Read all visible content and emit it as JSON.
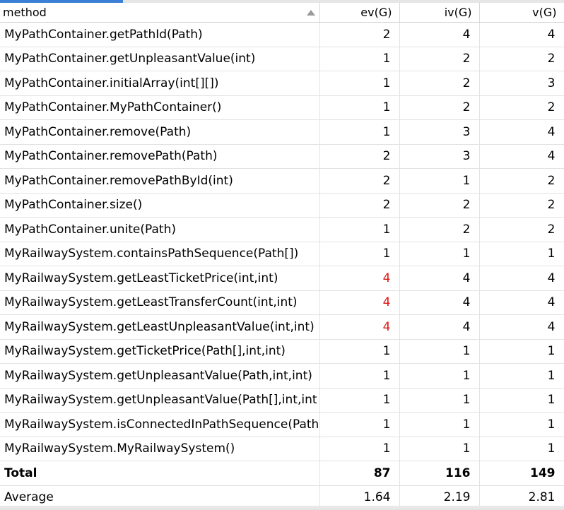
{
  "columns": {
    "method": "method",
    "ev": "ev(G)",
    "iv": "iv(G)",
    "v": "v(G)"
  },
  "colors": {
    "warning": "#e01515",
    "accent": "#3c7fd6"
  },
  "sort_icon": "sort-ascending-icon",
  "rows": [
    {
      "method": "MyPathContainer.getPathId(Path)",
      "ev": "2",
      "iv": "4",
      "v": "4",
      "ev_warn": false
    },
    {
      "method": "MyPathContainer.getUnpleasantValue(int)",
      "ev": "1",
      "iv": "2",
      "v": "2",
      "ev_warn": false
    },
    {
      "method": "MyPathContainer.initialArray(int[][])",
      "ev": "1",
      "iv": "2",
      "v": "3",
      "ev_warn": false
    },
    {
      "method": "MyPathContainer.MyPathContainer()",
      "ev": "1",
      "iv": "2",
      "v": "2",
      "ev_warn": false
    },
    {
      "method": "MyPathContainer.remove(Path)",
      "ev": "1",
      "iv": "3",
      "v": "4",
      "ev_warn": false
    },
    {
      "method": "MyPathContainer.removePath(Path)",
      "ev": "2",
      "iv": "3",
      "v": "4",
      "ev_warn": false
    },
    {
      "method": "MyPathContainer.removePathById(int)",
      "ev": "2",
      "iv": "1",
      "v": "2",
      "ev_warn": false
    },
    {
      "method": "MyPathContainer.size()",
      "ev": "2",
      "iv": "2",
      "v": "2",
      "ev_warn": false
    },
    {
      "method": "MyPathContainer.unite(Path)",
      "ev": "1",
      "iv": "2",
      "v": "2",
      "ev_warn": false
    },
    {
      "method": "MyRailwaySystem.containsPathSequence(Path[])",
      "ev": "1",
      "iv": "1",
      "v": "1",
      "ev_warn": false
    },
    {
      "method": "MyRailwaySystem.getLeastTicketPrice(int,int)",
      "ev": "4",
      "iv": "4",
      "v": "4",
      "ev_warn": true
    },
    {
      "method": "MyRailwaySystem.getLeastTransferCount(int,int)",
      "ev": "4",
      "iv": "4",
      "v": "4",
      "ev_warn": true
    },
    {
      "method": "MyRailwaySystem.getLeastUnpleasantValue(int,int)",
      "ev": "4",
      "iv": "4",
      "v": "4",
      "ev_warn": true
    },
    {
      "method": "MyRailwaySystem.getTicketPrice(Path[],int,int)",
      "ev": "1",
      "iv": "1",
      "v": "1",
      "ev_warn": false
    },
    {
      "method": "MyRailwaySystem.getUnpleasantValue(Path,int,int)",
      "ev": "1",
      "iv": "1",
      "v": "1",
      "ev_warn": false
    },
    {
      "method": "MyRailwaySystem.getUnpleasantValue(Path[],int,int",
      "ev": "1",
      "iv": "1",
      "v": "1",
      "ev_warn": false
    },
    {
      "method": "MyRailwaySystem.isConnectedInPathSequence(Path",
      "ev": "1",
      "iv": "1",
      "v": "1",
      "ev_warn": false
    },
    {
      "method": "MyRailwaySystem.MyRailwaySystem()",
      "ev": "1",
      "iv": "1",
      "v": "1",
      "ev_warn": false
    }
  ],
  "total": {
    "label": "Total",
    "ev": "87",
    "iv": "116",
    "v": "149"
  },
  "average": {
    "label": "Average",
    "ev": "1.64",
    "iv": "2.19",
    "v": "2.81"
  }
}
